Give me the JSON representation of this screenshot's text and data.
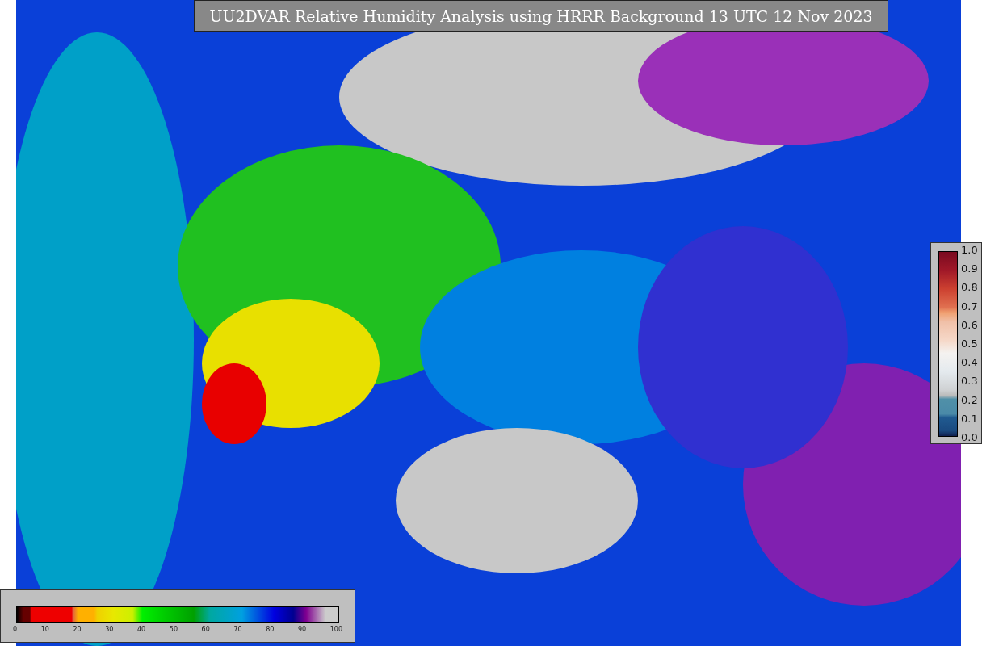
{
  "title": "UU2DVAR Relative Humidity Analysis using HRRR Background 13 UTC 12 Nov 2023",
  "humidity_colorbar": {
    "ticks": [
      "0",
      "10",
      "20",
      "30",
      "40",
      "50",
      "60",
      "70",
      "80",
      "90",
      "100"
    ]
  },
  "observation_colorbar": {
    "ticks": [
      "1.0",
      "0.9",
      "0.8",
      "0.7",
      "0.6",
      "0.5",
      "0.4",
      "0.3",
      "0.2",
      "0.1",
      "0.0"
    ]
  }
}
